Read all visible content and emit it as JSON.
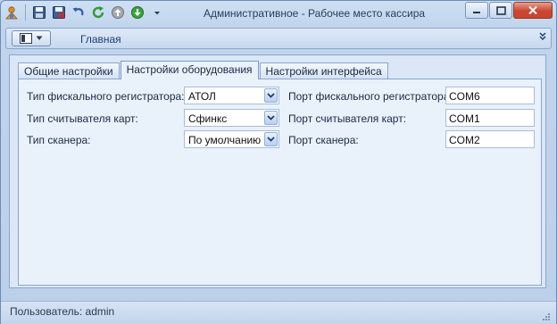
{
  "window": {
    "title": "Административное - Рабочее место кассира",
    "colors": {
      "frame": "#6d8bb5",
      "close_button": "#c9452f",
      "accent": "#1f3f75"
    }
  },
  "quick_access": [
    {
      "icon": "app-logo-icon"
    },
    {
      "icon": "save-icon"
    },
    {
      "icon": "save-close-icon"
    },
    {
      "icon": "undo-icon"
    },
    {
      "icon": "refresh-icon"
    },
    {
      "icon": "navigate-up-icon"
    },
    {
      "icon": "navigate-down-icon"
    },
    {
      "icon": "customize-dropdown-icon"
    }
  ],
  "ribbon": {
    "tab_label": "Главная"
  },
  "tabs": [
    {
      "label": "Общие настройки"
    },
    {
      "label": "Настройки оборудования"
    },
    {
      "label": "Настройки интерфейса"
    }
  ],
  "active_tab": "Настройки оборудования",
  "form": {
    "fiscal_type": {
      "label": "Тип фискального регистратора:",
      "value": "АТОЛ"
    },
    "card_reader_type": {
      "label": "Тип считывателя карт:",
      "value": "Сфинкс"
    },
    "scanner_type": {
      "label": "Тип сканера:",
      "value": "По умолчанию"
    },
    "fiscal_port": {
      "label": "Порт фискального регистратора:",
      "value": "COM6"
    },
    "card_reader_port": {
      "label": "Порт считывателя карт:",
      "value": "COM1"
    },
    "scanner_port": {
      "label": "Порт сканера:",
      "value": "COM2"
    }
  },
  "status": {
    "text": "Пользователь: admin"
  }
}
